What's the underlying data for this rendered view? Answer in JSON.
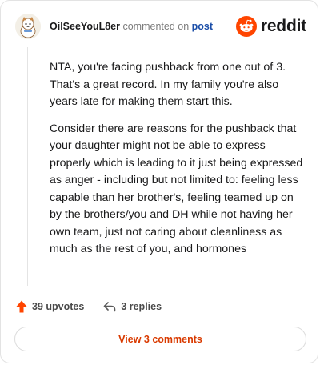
{
  "header": {
    "username": "OilSeeYouL8er",
    "commented_text": "commented on",
    "post_link": "post",
    "brand_name": "reddit",
    "brand_color": "#ff4500"
  },
  "comment": {
    "paragraphs": [
      "NTA, you're facing pushback from one out of 3. That's a great record. In my family you're also years late for making them start this.",
      "Consider there are reasons for the pushback that your daughter might not be able to express properly which is leading to it just being expressed as anger - including but not limited to: feeling less capable than her brother's, feeling teamed up on by the brothers/you and DH while not having her own team, just not caring about cleanliness as much as the rest of you, and hormones"
    ]
  },
  "actions": {
    "upvotes_label": "39 upvotes",
    "replies_label": "3 replies",
    "upvote_icon": "upvote-arrow-icon",
    "reply_icon": "reply-arrow-icon",
    "upvote_color": "#ff4500"
  },
  "footer": {
    "view_comments_label": "View 3 comments",
    "accent_color": "#d93a00"
  }
}
